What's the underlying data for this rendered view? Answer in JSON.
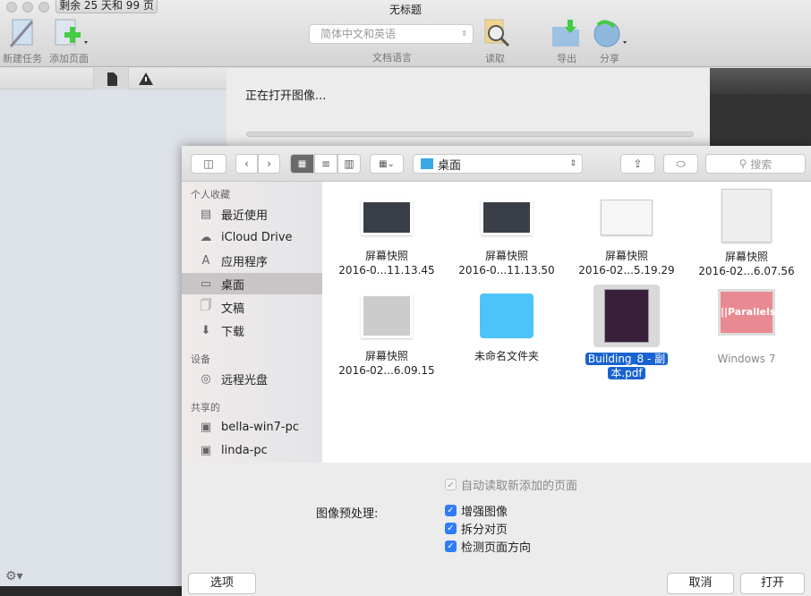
{
  "window": {
    "title": "无标题",
    "trial_badge": "剩余 25 天和 99 页"
  },
  "toolbar": {
    "new_task": "新建任务",
    "add_page": "添加页面",
    "language_value": "简体中文和英语",
    "language_label": "文档语言",
    "read": "读取",
    "export": "导出",
    "share": "分享"
  },
  "progress": {
    "message": "正在打开图像...",
    "value": 0
  },
  "dialog": {
    "location": "桌面",
    "search_placeholder": "搜索",
    "sidebar": {
      "favorites_header": "个人收藏",
      "favorites": [
        {
          "label": "最近使用",
          "icon": "recents-icon"
        },
        {
          "label": "iCloud Drive",
          "icon": "cloud-icon"
        },
        {
          "label": "应用程序",
          "icon": "applications-icon"
        },
        {
          "label": "桌面",
          "icon": "desktop-icon",
          "selected": true
        },
        {
          "label": "文稿",
          "icon": "documents-icon"
        },
        {
          "label": "下载",
          "icon": "downloads-icon"
        }
      ],
      "devices_header": "设备",
      "devices": [
        {
          "label": "远程光盘",
          "icon": "disc-icon"
        }
      ],
      "shared_header": "共享的",
      "shared": [
        {
          "label": "bella-win7-pc",
          "icon": "computer-icon"
        },
        {
          "label": "linda-pc",
          "icon": "computer-icon"
        }
      ]
    },
    "files": [
      {
        "line1": "屏幕快照",
        "line2": "2016-0...11.13.45"
      },
      {
        "line1": "屏幕快照",
        "line2": "2016-0...11.13.50"
      },
      {
        "line1": "屏幕快照",
        "line2": "2016-02...5.19.29"
      },
      {
        "line1": "屏幕快照",
        "line2": "2016-02...6.07.56"
      },
      {
        "line1": "屏幕快照",
        "line2": "2016-02...6.09.15"
      },
      {
        "line1": "未命名文件夹",
        "line2": ""
      },
      {
        "line1": "Building_8 - 副",
        "line2": "本.pdf",
        "selected": true
      },
      {
        "line1": "Windows 7",
        "line2": "",
        "thumb_text": "||Parallels"
      }
    ],
    "options": {
      "auto_read": {
        "label": "自动读取新添加的页面",
        "checked": true,
        "disabled": true
      },
      "preprocess_label": "图像预处理:",
      "enhance": {
        "label": "增强图像",
        "checked": true
      },
      "split": {
        "label": "拆分对页",
        "checked": true
      },
      "detect": {
        "label": "检测页面方向",
        "checked": true
      }
    },
    "buttons": {
      "options": "选项",
      "cancel": "取消",
      "open": "打开"
    }
  },
  "colors": {
    "accent": "#2f7cf6",
    "selection": "#1963d0"
  }
}
